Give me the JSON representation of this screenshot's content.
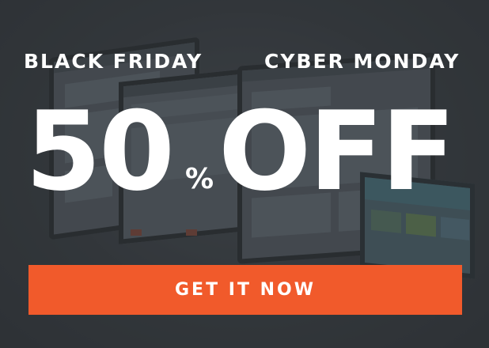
{
  "promo": {
    "left_heading": "BLACK FRIDAY",
    "right_heading": "CYBER MONDAY",
    "discount_number": "50",
    "discount_symbol": "%",
    "discount_word": "OFF",
    "cta_label": "GET IT NOW"
  },
  "colors": {
    "background": "#3a3e42",
    "text": "#ffffff",
    "accent": "#f15a2b"
  }
}
